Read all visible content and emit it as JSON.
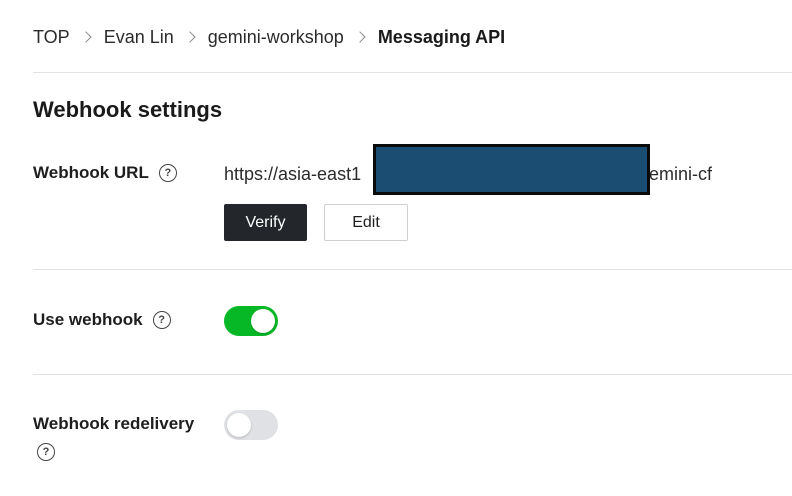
{
  "breadcrumb": {
    "items": [
      "TOP",
      "Evan Lin",
      "gemini-workshop",
      "Messaging API"
    ]
  },
  "section": {
    "title": "Webhook settings"
  },
  "webhook_url": {
    "label": "Webhook URL",
    "help_glyph": "?",
    "value_prefix": "https://asia-east1",
    "value_suffix": "emini-cf",
    "redaction_color": "#1b4d72",
    "verify_label": "Verify",
    "edit_label": "Edit"
  },
  "use_webhook": {
    "label": "Use webhook",
    "help_glyph": "?",
    "enabled": true
  },
  "webhook_redelivery": {
    "label": "Webhook redelivery",
    "help_glyph": "?",
    "enabled": false
  },
  "colors": {
    "toggle_on": "#06b826",
    "toggle_off": "#dfe1e4",
    "primary_button": "#23272b"
  }
}
